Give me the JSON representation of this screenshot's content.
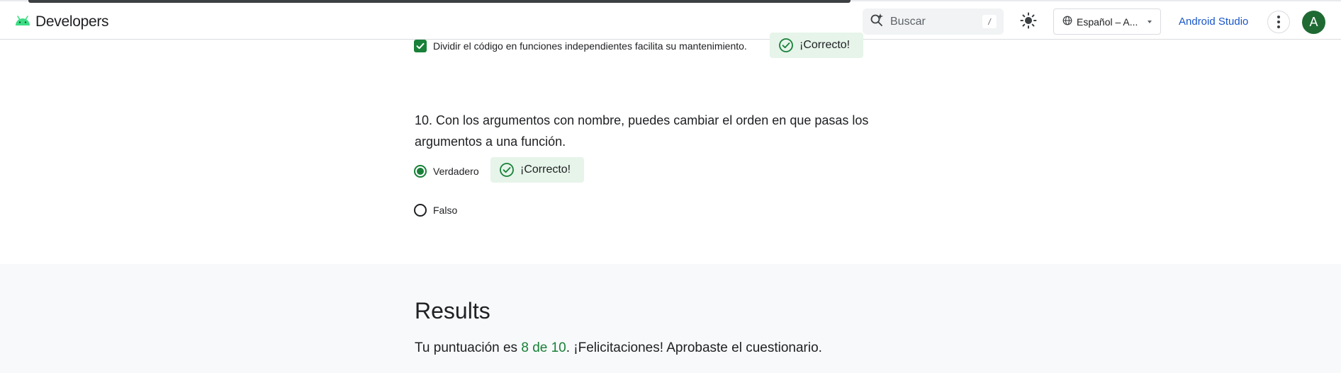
{
  "header": {
    "brand": "Developers",
    "search_placeholder": "Buscar",
    "search_shortcut": "/",
    "language": "Español – A...",
    "studio_link": "Android Studio",
    "avatar_initial": "A"
  },
  "quiz": {
    "prev_option": {
      "text": "Dividir el código en funciones independientes facilita su mantenimiento.",
      "checked": true,
      "feedback": "¡Correcto!"
    },
    "question10": {
      "title": "10. Con los argumentos con nombre, puedes cambiar el orden en que pasas los argumentos a una función.",
      "options": [
        {
          "label": "Verdadero",
          "selected": true,
          "feedback": "¡Correcto!"
        },
        {
          "label": "Falso",
          "selected": false
        }
      ]
    }
  },
  "results": {
    "heading": "Results",
    "score_prefix": "Tu puntuación es ",
    "score_value": "8 de 10",
    "score_suffix": ". ¡Felicitaciones! Aprobaste el cuestionario."
  },
  "colors": {
    "accent": "#188038",
    "link": "#1a56c7",
    "correct_bg": "#e6f4ea"
  }
}
